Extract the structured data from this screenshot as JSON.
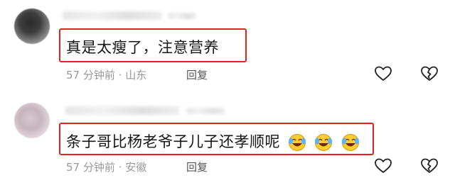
{
  "comments": [
    {
      "text": "真是太瘦了，注意营养",
      "time": "57 分钟前",
      "separator": "·",
      "location": "山东",
      "reply_label": "回复"
    },
    {
      "text": "条子哥比杨老爷子儿子还孝顺呢",
      "emoji_names": [
        "laughing-crying-emoji",
        "laughing-crying-emoji",
        "laughing-crying-emoji"
      ],
      "time": "57 分钟前",
      "separator": "·",
      "location": "安徽",
      "reply_label": "回复"
    }
  ],
  "icons": {
    "like": "heart-outline-icon",
    "dislike": "broken-heart-icon"
  },
  "colors": {
    "highlight_border": "#e0231e",
    "meta_text": "#999999",
    "reply_text": "#555555"
  }
}
